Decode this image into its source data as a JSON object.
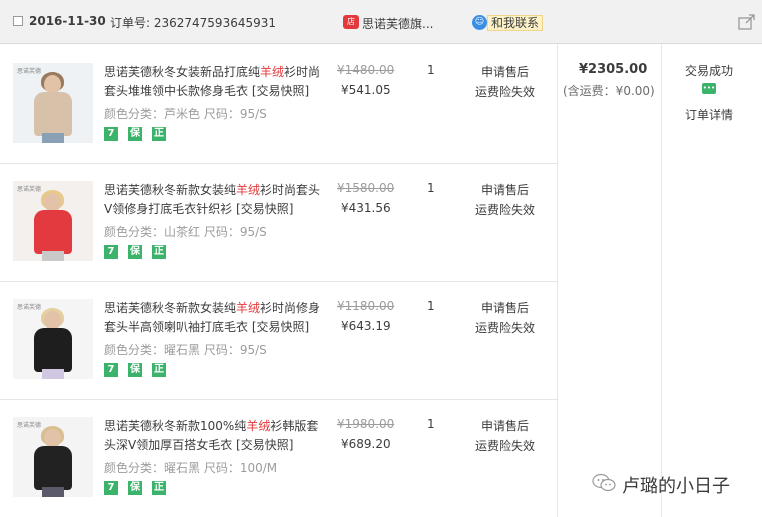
{
  "order": {
    "date": "2016-11-30",
    "number_label": "订单号: 2362747593645931",
    "shop_icon": "shop-badge-icon",
    "shop_name": "思诺芙德旗...",
    "contact_label": "和我联系",
    "total": "¥2305.00",
    "shipping": "(含运费：¥0.00)",
    "status": "交易成功",
    "detail_label": "订单详情"
  },
  "items": [
    {
      "title_pre": "思诺芙德秋冬女装新品打底纯",
      "title_hl": "羊绒",
      "title_post": "衫时尚套头堆堆领中长款修身毛衣 [交易快照]",
      "spec": "颜色分类：芦米色   尺码：95/S",
      "orig_price": "¥1480.00",
      "price": "¥541.05",
      "qty": "1",
      "service1": "申请售后",
      "service2": "运费险失效",
      "image_color": "#d7c1a8",
      "image_bg": "#eef2f4"
    },
    {
      "title_pre": "思诺芙德秋冬新款女装纯",
      "title_hl": "羊绒",
      "title_post": "衫时尚套头V领修身打底毛衣针织衫 [交易快照]",
      "spec": "颜色分类：山茶红   尺码：95/S",
      "orig_price": "¥1580.00",
      "price": "¥431.56",
      "qty": "1",
      "service1": "申请售后",
      "service2": "运费险失效",
      "image_color": "#e23a3f",
      "image_bg": "#f3f0ee"
    },
    {
      "title_pre": "思诺芙德秋冬新款女装纯",
      "title_hl": "羊绒",
      "title_post": "衫时尚修身套头半高领喇叭袖打底毛衣 [交易快照]",
      "spec": "颜色分类：曜石黑   尺码：95/S",
      "orig_price": "¥1180.00",
      "price": "¥643.19",
      "qty": "1",
      "service1": "申请售后",
      "service2": "运费险失效",
      "image_color": "#1e1e1e",
      "image_bg": "#f5f5f5"
    },
    {
      "title_pre": "思诺芙德秋冬新款100%纯",
      "title_hl": "羊绒",
      "title_post": "衫韩版套头深V领加厚百搭女毛衣 [交易快照]",
      "spec": "颜色分类：曜石黑   尺码：100/M",
      "orig_price": "¥1980.00",
      "price": "¥689.20",
      "qty": "1",
      "service1": "申请售后",
      "service2": "运费险失效",
      "image_color": "#222222",
      "image_bg": "#f4f4f4"
    }
  ],
  "badges": [
    "7",
    "保",
    "正"
  ],
  "watermark": "卢璐的小日子",
  "colors": {
    "accent_red": "#e4393c",
    "badge_green": "#3bb36b"
  }
}
